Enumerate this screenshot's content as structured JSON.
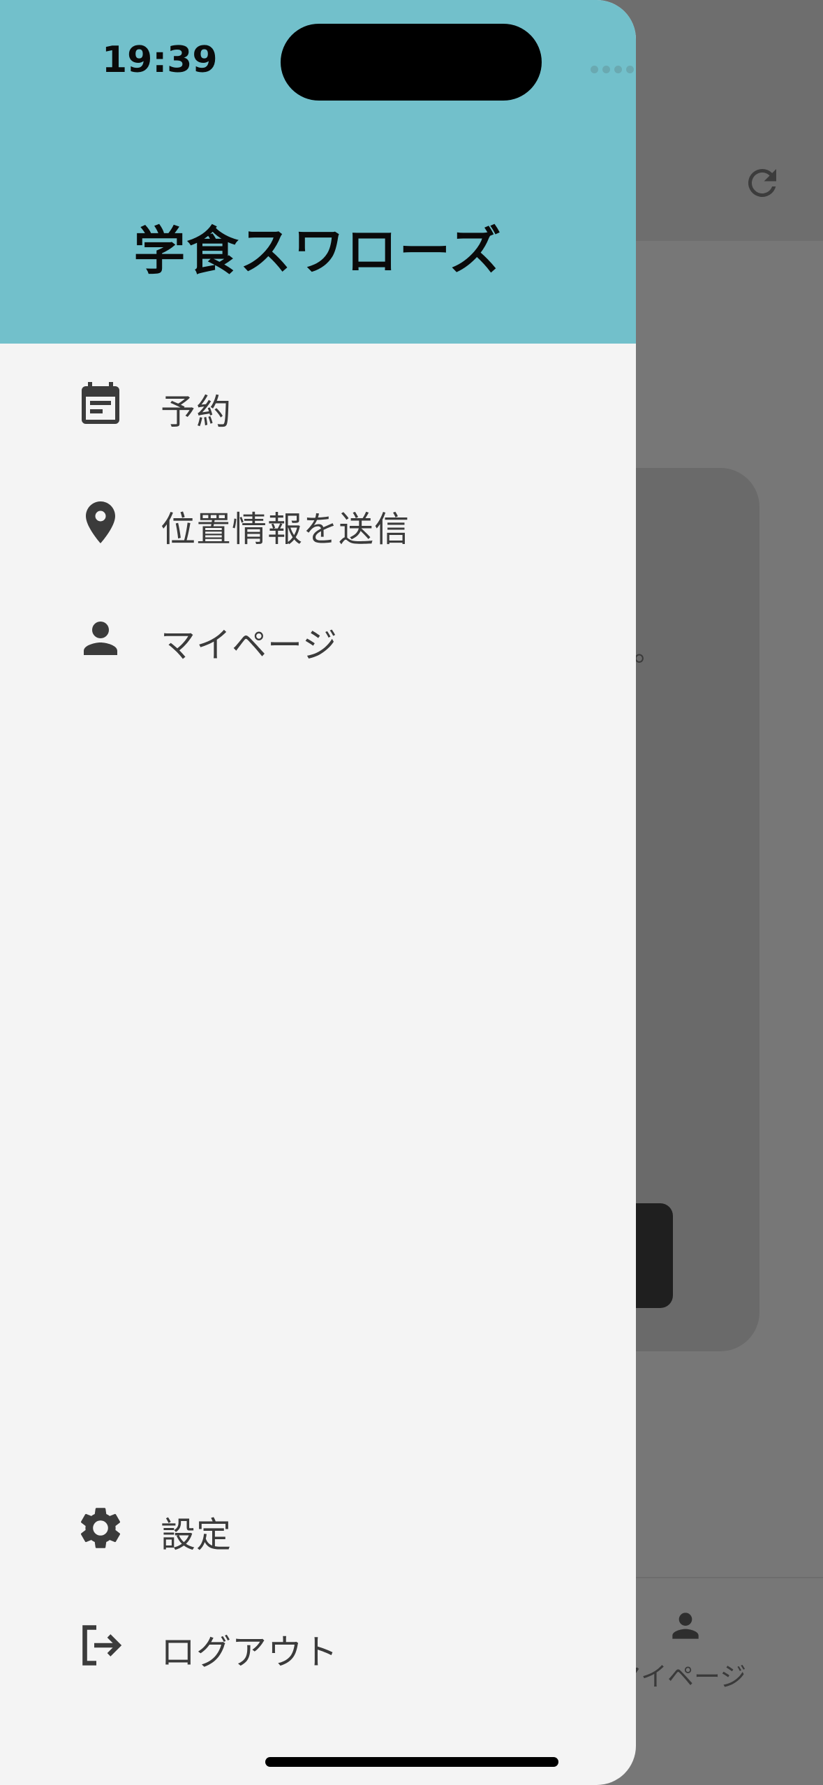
{
  "status_bar": {
    "time": "19:39",
    "icons": [
      "signal-dots",
      "wifi-icon",
      "battery-icon"
    ]
  },
  "drawer": {
    "title": "学食スワローズ",
    "header_color": "#72c0cb",
    "items": [
      {
        "label": "予約",
        "icon": "calendar-icon"
      },
      {
        "label": "位置情報を送信",
        "icon": "location-pin-icon"
      },
      {
        "label": "マイページ",
        "icon": "person-icon"
      }
    ],
    "bottom_items": [
      {
        "label": "設定",
        "icon": "gear-icon"
      },
      {
        "label": "ログアウト",
        "icon": "logout-icon"
      }
    ]
  },
  "background": {
    "card_text": "。",
    "bottom_nav_label": "マイページ",
    "icons": [
      "refresh-icon",
      "person-icon"
    ]
  }
}
